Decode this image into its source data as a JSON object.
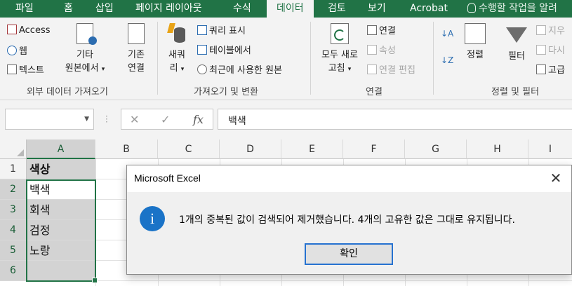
{
  "ribbon_tabs": [
    {
      "label": "파일",
      "active": false
    },
    {
      "label": "홈",
      "active": false
    },
    {
      "label": "삽입",
      "active": false
    },
    {
      "label": "페이지 레이아웃",
      "active": false
    },
    {
      "label": "수식",
      "active": false
    },
    {
      "label": "데이터",
      "active": true
    },
    {
      "label": "검토",
      "active": false
    },
    {
      "label": "보기",
      "active": false
    },
    {
      "label": "Acrobat",
      "active": false
    }
  ],
  "tell_me": "수행할 작업을 알려",
  "groups": {
    "external": {
      "label": "외부 데이터 가져오기",
      "access": "Access",
      "web": "웹",
      "text": "텍스트",
      "other_line1": "기타",
      "other_line2": "원본에서",
      "existing_line1": "기존",
      "existing_line2": "연결"
    },
    "transform": {
      "label": "가져오기 및 변환",
      "new_query_line1": "새쿼",
      "new_query_line2": "리",
      "show_queries": "쿼리 표시",
      "from_table": "테이블에서",
      "recent_sources": "최근에 사용한 원본"
    },
    "connections": {
      "label": "연결",
      "refresh_all_line1": "모두 새로",
      "refresh_all_line2": "고침",
      "connections": "연결",
      "properties": "속성",
      "edit_links": "연결 편집"
    },
    "sort_filter": {
      "label": "정렬 및 필터",
      "sort": "정렬",
      "filter": "필터",
      "clear": "지우",
      "reapply": "다시",
      "advanced": "고급"
    }
  },
  "formula_bar": {
    "name_box": "",
    "cancel_glyph": "✕",
    "enter_glyph": "✓",
    "fx_glyph": "fx",
    "value": "백색"
  },
  "columns": [
    "A",
    "B",
    "C",
    "D",
    "E",
    "F",
    "G",
    "H",
    "I"
  ],
  "rows": [
    "1",
    "2",
    "3",
    "4",
    "5",
    "6"
  ],
  "cells": {
    "A1": "색상",
    "A2": "백색",
    "A3": "회색",
    "A4": "검정",
    "A5": "노랑",
    "A6": ""
  },
  "dialog": {
    "title": "Microsoft Excel",
    "close_glyph": "✕",
    "icon_glyph": "i",
    "message": "1개의 중복된 값이 검색되어 제거했습니다. 4개의 고유한 값은 그대로 유지됩니다.",
    "ok_label": "확인"
  },
  "colors": {
    "accent": "#217346",
    "info_icon": "#1a73c7",
    "button_focus": "#2672d0"
  }
}
